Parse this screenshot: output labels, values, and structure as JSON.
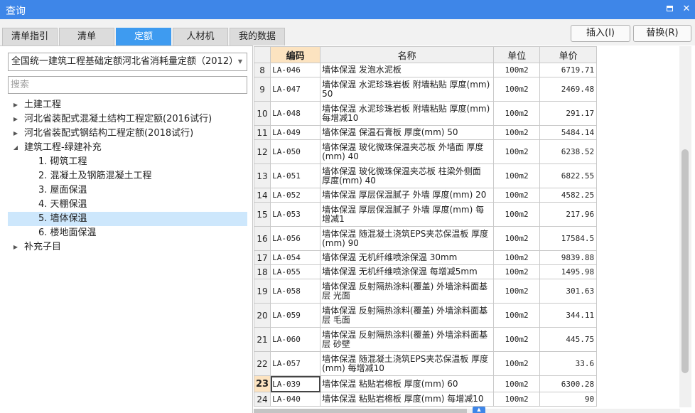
{
  "window": {
    "title": "查询"
  },
  "tabs": [
    {
      "label": "清单指引",
      "active": false
    },
    {
      "label": "清单",
      "active": false
    },
    {
      "label": "定额",
      "active": true
    },
    {
      "label": "人材机",
      "active": false
    },
    {
      "label": "我的数据",
      "active": false
    }
  ],
  "actions": {
    "insert": "插入(I)",
    "replace": "替换(R)"
  },
  "left": {
    "library": "全国统一建筑工程基础定额河北省消耗量定额（2012）",
    "search_placeholder": "搜索",
    "tree": [
      {
        "label": "土建工程",
        "level": 0,
        "arrow": "collapsed",
        "selected": false
      },
      {
        "label": "河北省装配式混凝土结构工程定额(2016试行)",
        "level": 0,
        "arrow": "collapsed",
        "selected": false
      },
      {
        "label": "河北省装配式钢结构工程定额(2018试行)",
        "level": 0,
        "arrow": "collapsed",
        "selected": false
      },
      {
        "label": "建筑工程-绿建补充",
        "level": 0,
        "arrow": "expanded",
        "selected": false
      },
      {
        "label": "1. 砌筑工程",
        "level": 1,
        "arrow": "none",
        "selected": false
      },
      {
        "label": "2. 混凝土及钢筋混凝土工程",
        "level": 1,
        "arrow": "none",
        "selected": false
      },
      {
        "label": "3. 屋面保温",
        "level": 1,
        "arrow": "none",
        "selected": false
      },
      {
        "label": "4. 天棚保温",
        "level": 1,
        "arrow": "none",
        "selected": false
      },
      {
        "label": "5. 墙体保温",
        "level": 1,
        "arrow": "none",
        "selected": true
      },
      {
        "label": "6. 楼地面保温",
        "level": 1,
        "arrow": "none",
        "selected": false
      },
      {
        "label": "补充子目",
        "level": 0,
        "arrow": "collapsed",
        "selected": false
      }
    ]
  },
  "grid": {
    "columns": {
      "code": "编码",
      "name": "名称",
      "unit": "单位",
      "price": "单价"
    },
    "rows": [
      {
        "num": "8",
        "code": "LA-046",
        "name": "墙体保温 发泡水泥板",
        "unit": "100m2",
        "price": "6719.71"
      },
      {
        "num": "9",
        "code": "LA-047",
        "name": "墙体保温 水泥珍珠岩板 附墙粘贴 厚度(mm) 50",
        "unit": "100m2",
        "price": "2469.48"
      },
      {
        "num": "10",
        "code": "LA-048",
        "name": "墙体保温 水泥珍珠岩板 附墙粘贴 厚度(mm) 每增减10",
        "unit": "100m2",
        "price": "291.17"
      },
      {
        "num": "11",
        "code": "LA-049",
        "name": "墙体保温 保温石膏板 厚度(mm) 50",
        "unit": "100m2",
        "price": "5484.14"
      },
      {
        "num": "12",
        "code": "LA-050",
        "name": "墙体保温 玻化微珠保温夹芯板 外墙面 厚度(mm) 40",
        "unit": "100m2",
        "price": "6238.52"
      },
      {
        "num": "13",
        "code": "LA-051",
        "name": "墙体保温 玻化微珠保温夹芯板 柱梁外侧面 厚度(mm) 40",
        "unit": "100m2",
        "price": "6822.55"
      },
      {
        "num": "14",
        "code": "LA-052",
        "name": "墙体保温 厚层保温腻子 外墙 厚度(mm) 20",
        "unit": "100m2",
        "price": "4582.25"
      },
      {
        "num": "15",
        "code": "LA-053",
        "name": "墙体保温 厚层保温腻子 外墙 厚度(mm) 每增减1",
        "unit": "100m2",
        "price": "217.96"
      },
      {
        "num": "16",
        "code": "LA-056",
        "name": "墙体保温 随混凝土浇筑EPS夹芯保温板 厚度(mm) 90",
        "unit": "100m2",
        "price": "17584.5"
      },
      {
        "num": "17",
        "code": "LA-054",
        "name": "墙体保温 无机纤维喷涂保温 30mm",
        "unit": "100m2",
        "price": "9839.88"
      },
      {
        "num": "18",
        "code": "LA-055",
        "name": "墙体保温 无机纤维喷涂保温 每增减5mm",
        "unit": "100m2",
        "price": "1495.98"
      },
      {
        "num": "19",
        "code": "LA-058",
        "name": "墙体保温 反射隔热涂料(覆盖) 外墙涂料面基层 光面",
        "unit": "100m2",
        "price": "301.63"
      },
      {
        "num": "20",
        "code": "LA-059",
        "name": "墙体保温 反射隔热涂料(覆盖) 外墙涂料面基层 毛面",
        "unit": "100m2",
        "price": "344.11"
      },
      {
        "num": "21",
        "code": "LA-060",
        "name": "墙体保温 反射隔热涂料(覆盖) 外墙涂料面基层 砂壁",
        "unit": "100m2",
        "price": "445.75"
      },
      {
        "num": "22",
        "code": "LA-057",
        "name": "墙体保温 随混凝土浇筑EPS夹芯保温板 厚度(mm) 每增减10",
        "unit": "100m2",
        "price": "33.6"
      },
      {
        "num": "23",
        "code": "LA-039",
        "name": "墙体保温 粘贴岩棉板 厚度(mm) 60",
        "unit": "100m2",
        "price": "6300.28",
        "current": true
      },
      {
        "num": "24",
        "code": "LA-040",
        "name": "墙体保温 粘贴岩棉板 厚度(mm) 每增减10",
        "unit": "100m2",
        "price": "90"
      }
    ]
  },
  "icons": {
    "maximize": "maximize-icon",
    "close": "close-icon",
    "dropdown": "chevron-down-icon",
    "tree_collapsed": "triangle-right-icon",
    "tree_expanded": "triangle-down-icon",
    "scroll": "chevron-up-icon"
  },
  "colors": {
    "titlebar": "#3e86e8",
    "active_tab": "#3e9bf0",
    "selected_row": "#cde7fc",
    "current_header": "#fce3c0"
  }
}
